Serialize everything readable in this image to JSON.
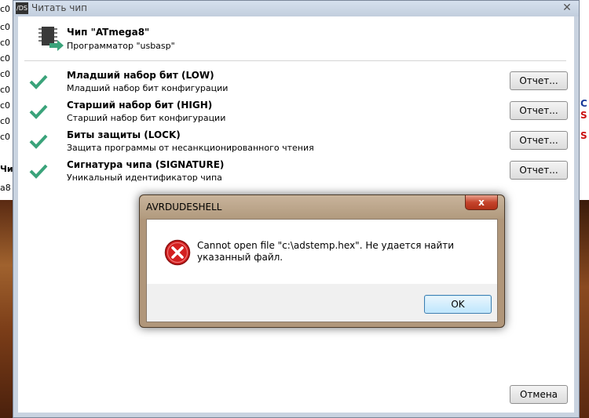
{
  "background": {
    "left_fragments": [
      "c0",
      "c0",
      "c0",
      "c0",
      "c0",
      "c0",
      "c0",
      "c0",
      "c0",
      "Чи",
      "a8"
    ],
    "right_fragments": [
      {
        "text": "C",
        "color": "blue"
      },
      {
        "text": "S",
        "color": "red"
      },
      {
        "text": "S",
        "color": "red"
      }
    ]
  },
  "window": {
    "icon_text": "/DS",
    "title": "Читать чип"
  },
  "chip": {
    "title": "Чип \"ATmega8\"",
    "programmer": "Программатор \"usbasp\""
  },
  "rows": [
    {
      "title": "Младший набор бит (LOW)",
      "subtitle": "Младший набор бит конфигурации",
      "button": "Отчет..."
    },
    {
      "title": "Старший набор бит (HIGH)",
      "subtitle": "Старший набор бит конфигурации",
      "button": "Отчет..."
    },
    {
      "title": "Биты защиты (LOCK)",
      "subtitle": "Защита программы от несанкционированного чтения",
      "button": "Отчет..."
    },
    {
      "title": "Сигнатура чипа (SIGNATURE)",
      "subtitle": "Уникальный идентификатор чипа",
      "button": "Отчет..."
    }
  ],
  "cancel_button": "Отмена",
  "dialog": {
    "title": "AVRDUDESHELL",
    "close_glyph": "x",
    "message": "Cannot open file \"c:\\adstemp.hex\". Не удается найти указанный файл.",
    "ok_button": "OK"
  },
  "colors": {
    "check": "#3aa37a",
    "error_red": "#d42020",
    "dialog_frame": "#b0967a"
  },
  "icons": {
    "chip": "chip-read-icon",
    "check": "checkmark-icon",
    "error": "error-icon"
  }
}
